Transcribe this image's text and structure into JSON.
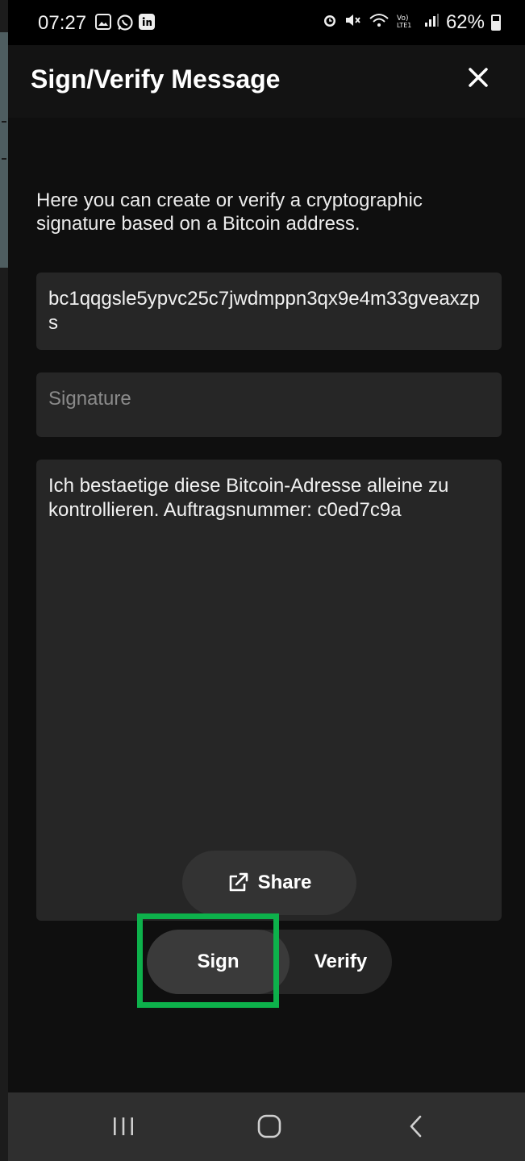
{
  "status_bar": {
    "time": "07:27",
    "battery": "62%",
    "battery_level": 0.62,
    "left_icons": [
      "gallery-icon",
      "whatsapp-icon",
      "linkedin-icon"
    ],
    "right_icons": [
      "alarm-icon",
      "mute-icon",
      "wifi-icon",
      "volte-icon",
      "signal-icon",
      "battery-icon"
    ]
  },
  "header": {
    "title": "Sign/Verify Message",
    "close_icon": "close-icon"
  },
  "content": {
    "intro": "Here you can create or verify a cryptographic signature based on a Bitcoin address.",
    "address_value": "bc1qqgsle5ypvc25c7jwdmppn3qx9e4m33gveaxzps",
    "signature_placeholder": "Signature",
    "message_value": "Ich bestaetige diese Bitcoin-Adresse alleine zu kontrollieren. Auftragsnummer: c0ed7c9a"
  },
  "actions": {
    "share_label": "Share",
    "share_icon": "external-link-icon",
    "sign_label": "Sign",
    "verify_label": "Verify",
    "highlight_color": "#0db14b"
  },
  "nav": {
    "items": [
      "recents-icon",
      "home-icon",
      "back-icon"
    ]
  }
}
